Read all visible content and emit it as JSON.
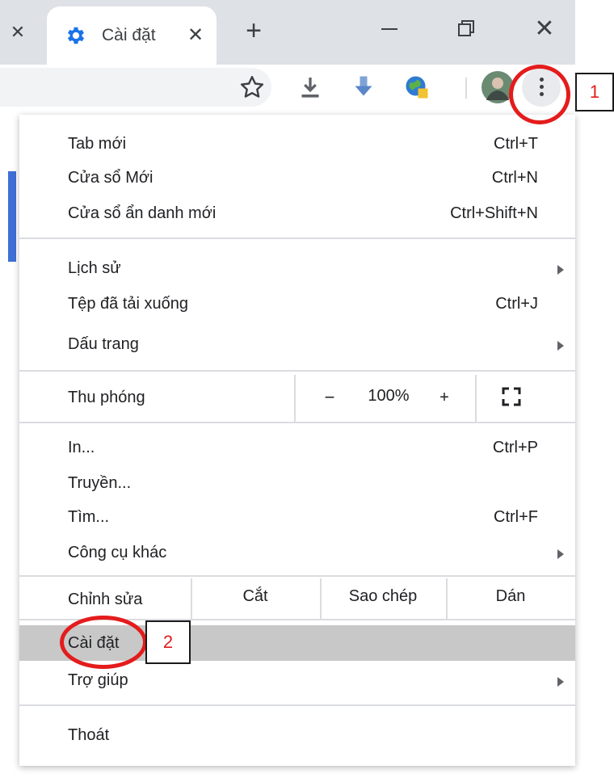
{
  "tab": {
    "title": "Cài đặt",
    "close_glyph": "✕",
    "icon": "gear-icon"
  },
  "tabstrip": {
    "prev_close_glyph": "✕",
    "new_tab_glyph": "+",
    "close_window_glyph": "✕"
  },
  "toolbar": {
    "icons": [
      "star-icon",
      "download-icon",
      "download-extension-icon",
      "globe-extension-icon",
      "avatar",
      "menu-icon"
    ]
  },
  "menu": {
    "group1": [
      {
        "label": "Tab mới",
        "shortcut": "Ctrl+T"
      },
      {
        "label": "Cửa sổ Mới",
        "shortcut": "Ctrl+N"
      },
      {
        "label": "Cửa sổ ẩn danh mới",
        "shortcut": "Ctrl+Shift+N"
      }
    ],
    "group2": [
      {
        "label": "Lịch sử",
        "shortcut": ""
      },
      {
        "label": "Tệp đã tải xuống",
        "shortcut": "Ctrl+J"
      },
      {
        "label": "Dấu trang",
        "shortcut": ""
      }
    ],
    "zoom": {
      "label": "Thu phóng",
      "minus": "−",
      "value": "100%",
      "plus": "+"
    },
    "group3": [
      {
        "label": "In...",
        "shortcut": "Ctrl+P"
      },
      {
        "label": "Truyền...",
        "shortcut": ""
      },
      {
        "label": "Tìm...",
        "shortcut": "Ctrl+F"
      },
      {
        "label": "Công cụ khác",
        "shortcut": ""
      }
    ],
    "edit": {
      "label": "Chỉnh sửa",
      "cut": "Cắt",
      "copy": "Sao chép",
      "paste": "Dán"
    },
    "group4": [
      {
        "label": "Cài đặt",
        "shortcut": ""
      },
      {
        "label": "Trợ giúp",
        "shortcut": ""
      }
    ],
    "exit": {
      "label": "Thoát"
    }
  },
  "annotations": {
    "step1": "1",
    "step2": "2",
    "ring_color": "#e41c1c"
  },
  "colors": {
    "tabstrip": "#dee1e6",
    "selected_item": "#c8c8c8",
    "accent": "#3d6fd6"
  }
}
